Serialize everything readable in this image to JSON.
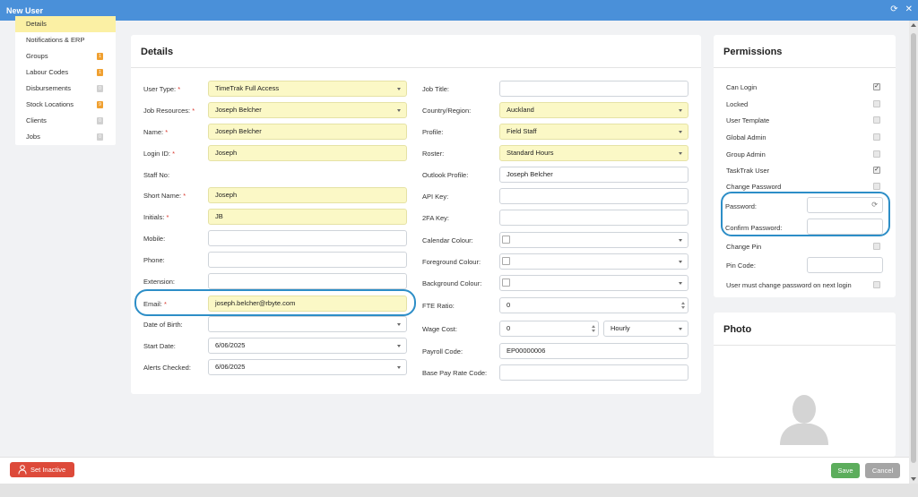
{
  "window": {
    "title": "New User"
  },
  "nav": {
    "items": [
      {
        "label": "Details",
        "active": true,
        "badge": ""
      },
      {
        "label": "Notifications & ERP",
        "active": false,
        "badge": ""
      },
      {
        "label": "Groups",
        "active": false,
        "badge": "1",
        "badge_color": "orange"
      },
      {
        "label": "Labour Codes",
        "active": false,
        "badge": "1",
        "badge_color": "orange"
      },
      {
        "label": "Disbursements",
        "active": false,
        "badge": "0",
        "badge_color": "grey"
      },
      {
        "label": "Stock Locations",
        "active": false,
        "badge": "9",
        "badge_color": "orange"
      },
      {
        "label": "Clients",
        "active": false,
        "badge": "0",
        "badge_color": "grey"
      },
      {
        "label": "Jobs",
        "active": false,
        "badge": "0",
        "badge_color": "grey"
      }
    ]
  },
  "details": {
    "title": "Details",
    "user_type": {
      "label": "User Type:",
      "value": "TimeTrak Full Access"
    },
    "job_resources": {
      "label": "Job Resources:",
      "value": "Joseph Belcher"
    },
    "name": {
      "label": "Name:",
      "value": "Joseph Belcher"
    },
    "login_id": {
      "label": "Login ID:",
      "value": "Joseph"
    },
    "staff_no": {
      "label": "Staff No:"
    },
    "short_name": {
      "label": "Short Name:",
      "value": "Joseph"
    },
    "initials": {
      "label": "Initials:",
      "value": "JB"
    },
    "mobile": {
      "label": "Mobile:",
      "value": ""
    },
    "phone": {
      "label": "Phone:",
      "value": ""
    },
    "extension": {
      "label": "Extension:",
      "value": ""
    },
    "email": {
      "label": "Email:",
      "value": "joseph.belcher@rbyte.com"
    },
    "dob": {
      "label": "Date of Birth:",
      "value": ""
    },
    "start_date": {
      "label": "Start Date:",
      "value": "6/06/2025"
    },
    "alerts_checked": {
      "label": "Alerts Checked:",
      "value": "6/06/2025"
    },
    "job_title": {
      "label": "Job Title:",
      "value": ""
    },
    "country": {
      "label": "Country/Region:",
      "value": "Auckland"
    },
    "profile": {
      "label": "Profile:",
      "value": "Field Staff"
    },
    "roster": {
      "label": "Roster:",
      "value": "Standard Hours"
    },
    "outlook_profile": {
      "label": "Outlook Profile:",
      "value": "Joseph Belcher"
    },
    "api_key": {
      "label": "API Key:",
      "value": ""
    },
    "twofa_key": {
      "label": "2FA Key:",
      "value": ""
    },
    "calendar_colour": {
      "label": "Calendar Colour:"
    },
    "foreground_colour": {
      "label": "Foreground Colour:"
    },
    "background_colour": {
      "label": "Background Colour:"
    },
    "fte_ratio": {
      "label": "FTE Ratio:",
      "value": "0"
    },
    "wage_cost": {
      "label": "Wage Cost:",
      "value": "0",
      "unit": "Hourly"
    },
    "payroll_code": {
      "label": "Payroll Code:",
      "value": "EP00000006"
    },
    "base_pay_rate_code": {
      "label": "Base Pay Rate Code:",
      "value": ""
    }
  },
  "permissions": {
    "title": "Permissions",
    "items": [
      {
        "label": "Can Login",
        "checked": true
      },
      {
        "label": "Locked",
        "checked": false
      },
      {
        "label": "User Template",
        "checked": false
      },
      {
        "label": "Global Admin",
        "checked": false
      },
      {
        "label": "Group Admin",
        "checked": false
      },
      {
        "label": "TaskTrak User",
        "checked": true
      },
      {
        "label": "Change Password",
        "checked": false
      }
    ],
    "password_label": "Password:",
    "confirm_password_label": "Confirm Password:",
    "change_pin_label": "Change Pin",
    "pin_code_label": "Pin Code:",
    "must_change_label": "User must change password on next login"
  },
  "photo": {
    "title": "Photo"
  },
  "footer": {
    "set_inactive": "Set Inactive",
    "save": "Save",
    "cancel": "Cancel"
  },
  "colors": {
    "titlebar": "#4a90d9",
    "required_field": "#fbf8c6",
    "highlight": "#2d8ec7",
    "save": "#5cad5c",
    "set_inactive": "#dd4a3a"
  }
}
